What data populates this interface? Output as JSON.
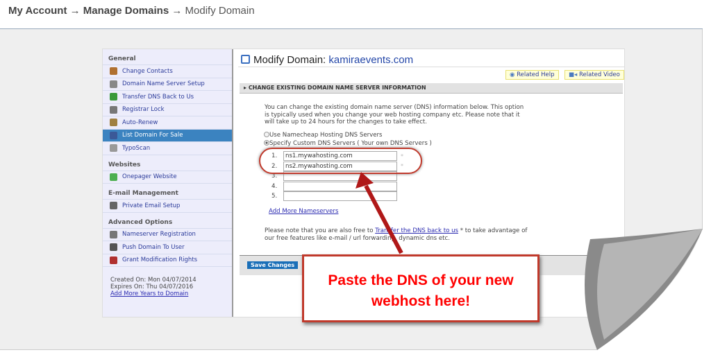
{
  "breadcrumb": {
    "part1": "My Account",
    "sep": "→",
    "part2": "Manage Domains",
    "part3": "Modify Domain"
  },
  "sidebar": {
    "sections": [
      {
        "title": "General",
        "items": [
          "Change Contacts",
          "Domain Name Server Setup",
          "Transfer DNS Back to Us",
          "Registrar Lock",
          "Auto-Renew",
          "List Domain For Sale",
          "TypoScan"
        ]
      },
      {
        "title": "Websites",
        "items": [
          "Onepager Website"
        ]
      },
      {
        "title": "E-mail Management",
        "items": [
          "Private Email Setup"
        ]
      },
      {
        "title": "Advanced Options",
        "items": [
          "Nameserver Registration",
          "Push Domain To User",
          "Grant Modification Rights"
        ]
      }
    ],
    "active_item": "List Domain For Sale",
    "created": "Created On: Mon 04/07/2014",
    "expires": "Expires On: Thu 04/07/2016",
    "add_years": "Add More Years to Domain"
  },
  "main": {
    "title_prefix": "Modify Domain:",
    "domain": "kamiraevents.com",
    "related_help": "Related Help",
    "related_video": "Related Video",
    "section_header": "CHANGE EXISTING DOMAIN NAME SERVER INFORMATION",
    "description": "You can change the existing domain name server (DNS) information below. This option is typically used when you change your web hosting company etc. Please note that it will take up to 24 hours for the changes to take effect.",
    "radio_namecheap": "Use Namecheap Hosting DNS Servers",
    "radio_custom": "Specify Custom DNS Servers ( Your own DNS Servers )",
    "selected_radio": "custom",
    "nameservers": [
      {
        "label": "1.",
        "value": "ns1.mywahosting.com"
      },
      {
        "label": "2.",
        "value": "ns2.mywahosting.com"
      },
      {
        "label": "3.",
        "value": ""
      },
      {
        "label": "4.",
        "value": ""
      },
      {
        "label": "5.",
        "value": ""
      }
    ],
    "add_more": "Add More Nameservers",
    "note_before": "Please note that you are also free to ",
    "note_link": "Transfer the DNS back to us",
    "note_after": " * to take advantage of our free features like e-mail / url forwarding, dynamic dns etc.",
    "save": "Save Changes"
  },
  "callout": {
    "line1": "Paste the DNS of your new",
    "line2": "webhost here!"
  },
  "colors": {
    "accent": "#3b83c0",
    "annotation": "#c0392b",
    "callout_text": "#ff0000"
  }
}
